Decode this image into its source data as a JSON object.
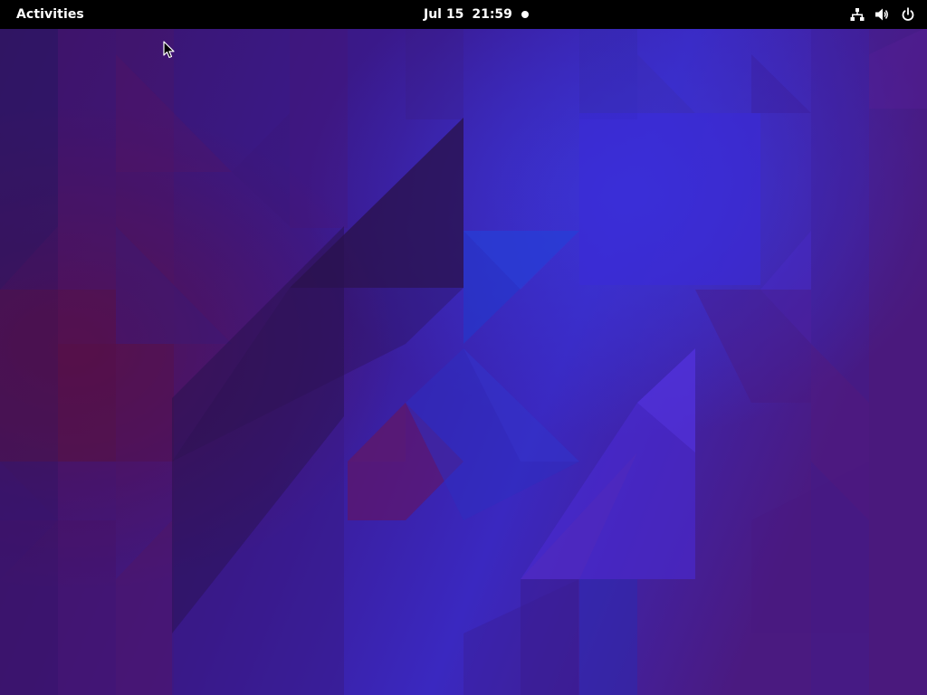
{
  "top_bar": {
    "activities_label": "Activities",
    "clock": {
      "date": "Jul 15",
      "time": "21:59"
    },
    "notification_indicator": "dot-icon",
    "status_icons": [
      "network-wired-icon",
      "volume-icon",
      "power-icon"
    ]
  },
  "wallpaper": {
    "style": "low-poly triangles",
    "colors": {
      "base": "#2a1a6a",
      "purple": "#4a1b7a",
      "magenta": "#5a1a5a",
      "blue": "#2a2ad0",
      "bright_blue": "#3a3ae0",
      "dark": "#1e1448"
    }
  },
  "cursor": "mouse-pointer-icon"
}
